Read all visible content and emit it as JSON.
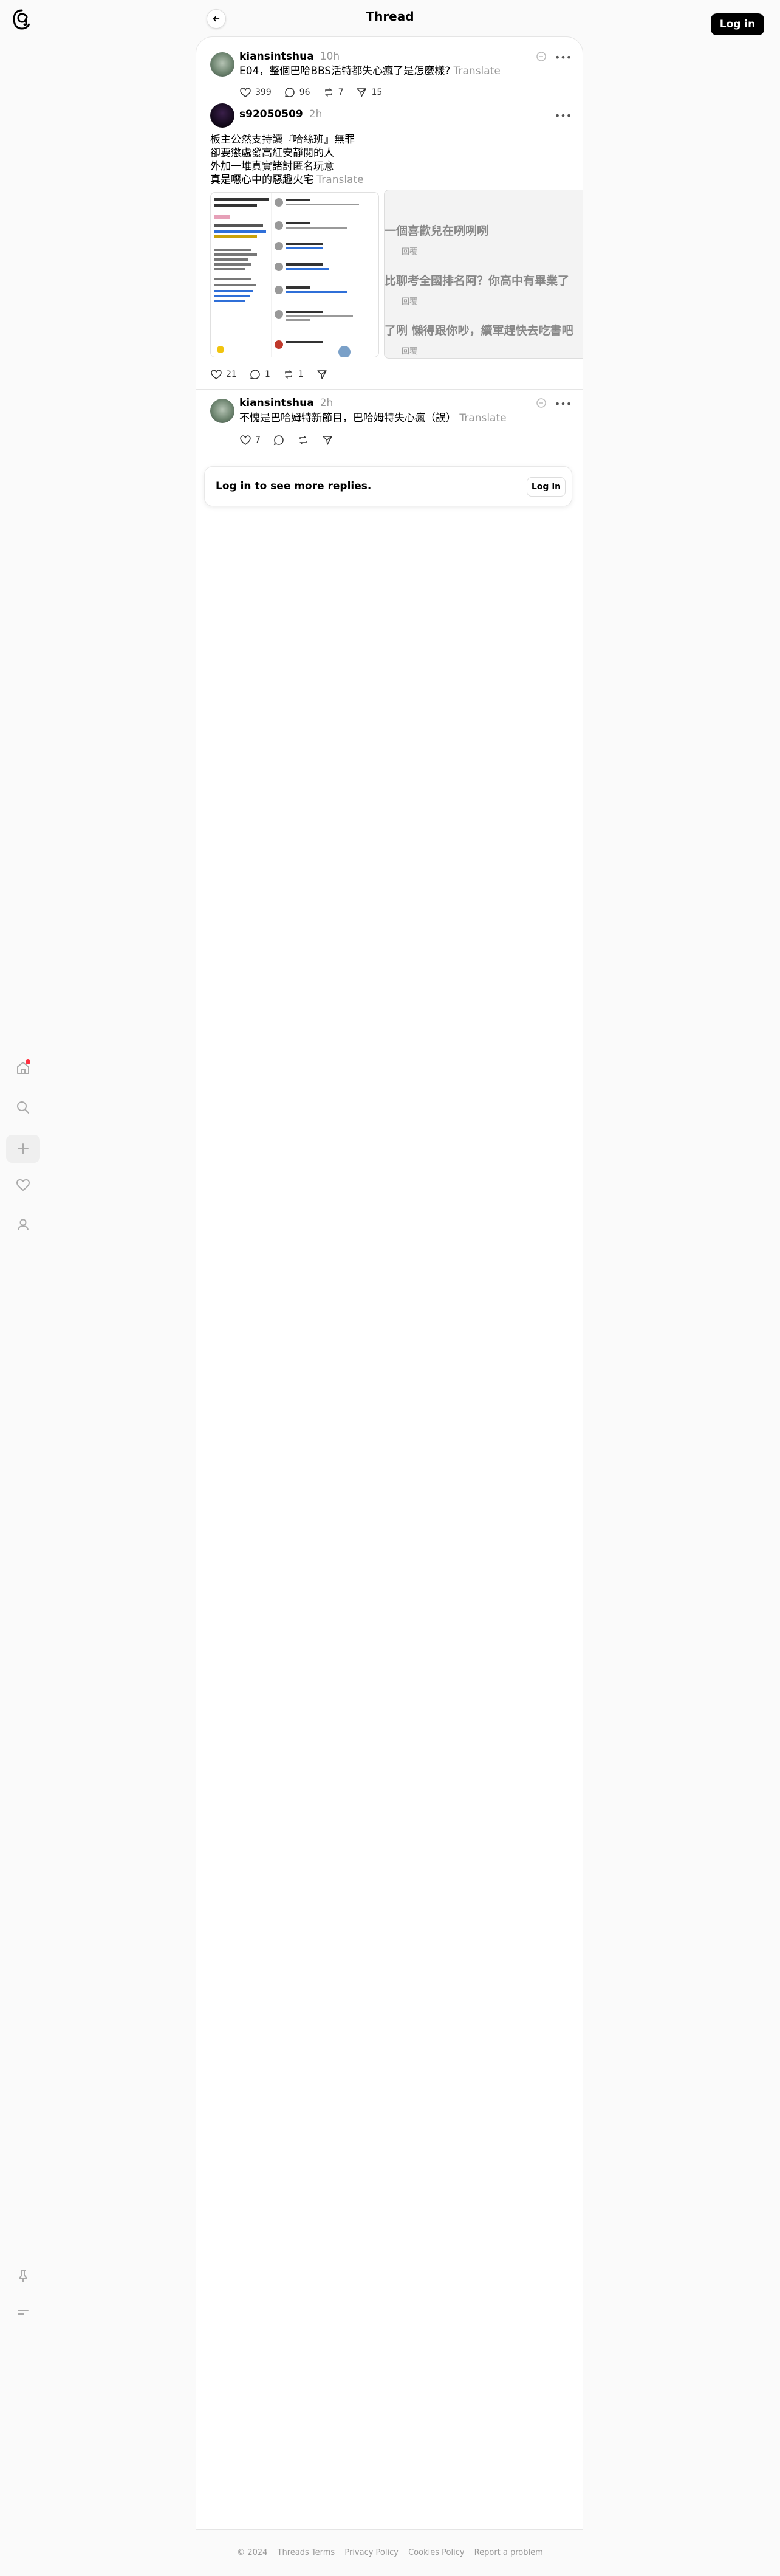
{
  "header": {
    "title": "Thread",
    "login_label": "Log in"
  },
  "posts": [
    {
      "username": "kiansintshua",
      "time": "10h",
      "text": "E04，整個巴哈BBS活特都失心瘋了是怎麼樣?",
      "translate": "Translate",
      "likes": "399",
      "replies": "96",
      "reposts": "7",
      "shares": "15"
    },
    {
      "username": "s92050509",
      "time": "2h",
      "lines": [
        "板主公然支持讀『哈絲班』無罪",
        "卻要懲處發高紅安靜閱的人",
        "外加一堆真實諸討匿名玩意",
        "真是噁心中的惡趣火宅"
      ],
      "translate": "Translate",
      "likes": "21",
      "replies": "1",
      "reposts": "1",
      "image_b_lines": [
        "一個喜歡兒在咧咧咧",
        "比聊考全國排名阿？你高中有畢業了",
        "了咧 懶得跟你吵，續軍趕快去吃書吧"
      ],
      "image_b_small": "回覆"
    },
    {
      "username": "kiansintshua",
      "time": "2h",
      "text": "不愧是巴哈姆特新節目，巴哈姆特失心瘋（誤）",
      "translate": "Translate",
      "likes": "7"
    }
  ],
  "login_prompt": {
    "text": "Log in to see more replies.",
    "button": "Log in"
  },
  "footer": {
    "copyright": "© 2024",
    "links": [
      "Threads Terms",
      "Privacy Policy",
      "Cookies Policy",
      "Report a problem"
    ]
  },
  "colors": {
    "accent": "#000000",
    "notification_dot": "#ff3040",
    "muted": "#999999"
  }
}
